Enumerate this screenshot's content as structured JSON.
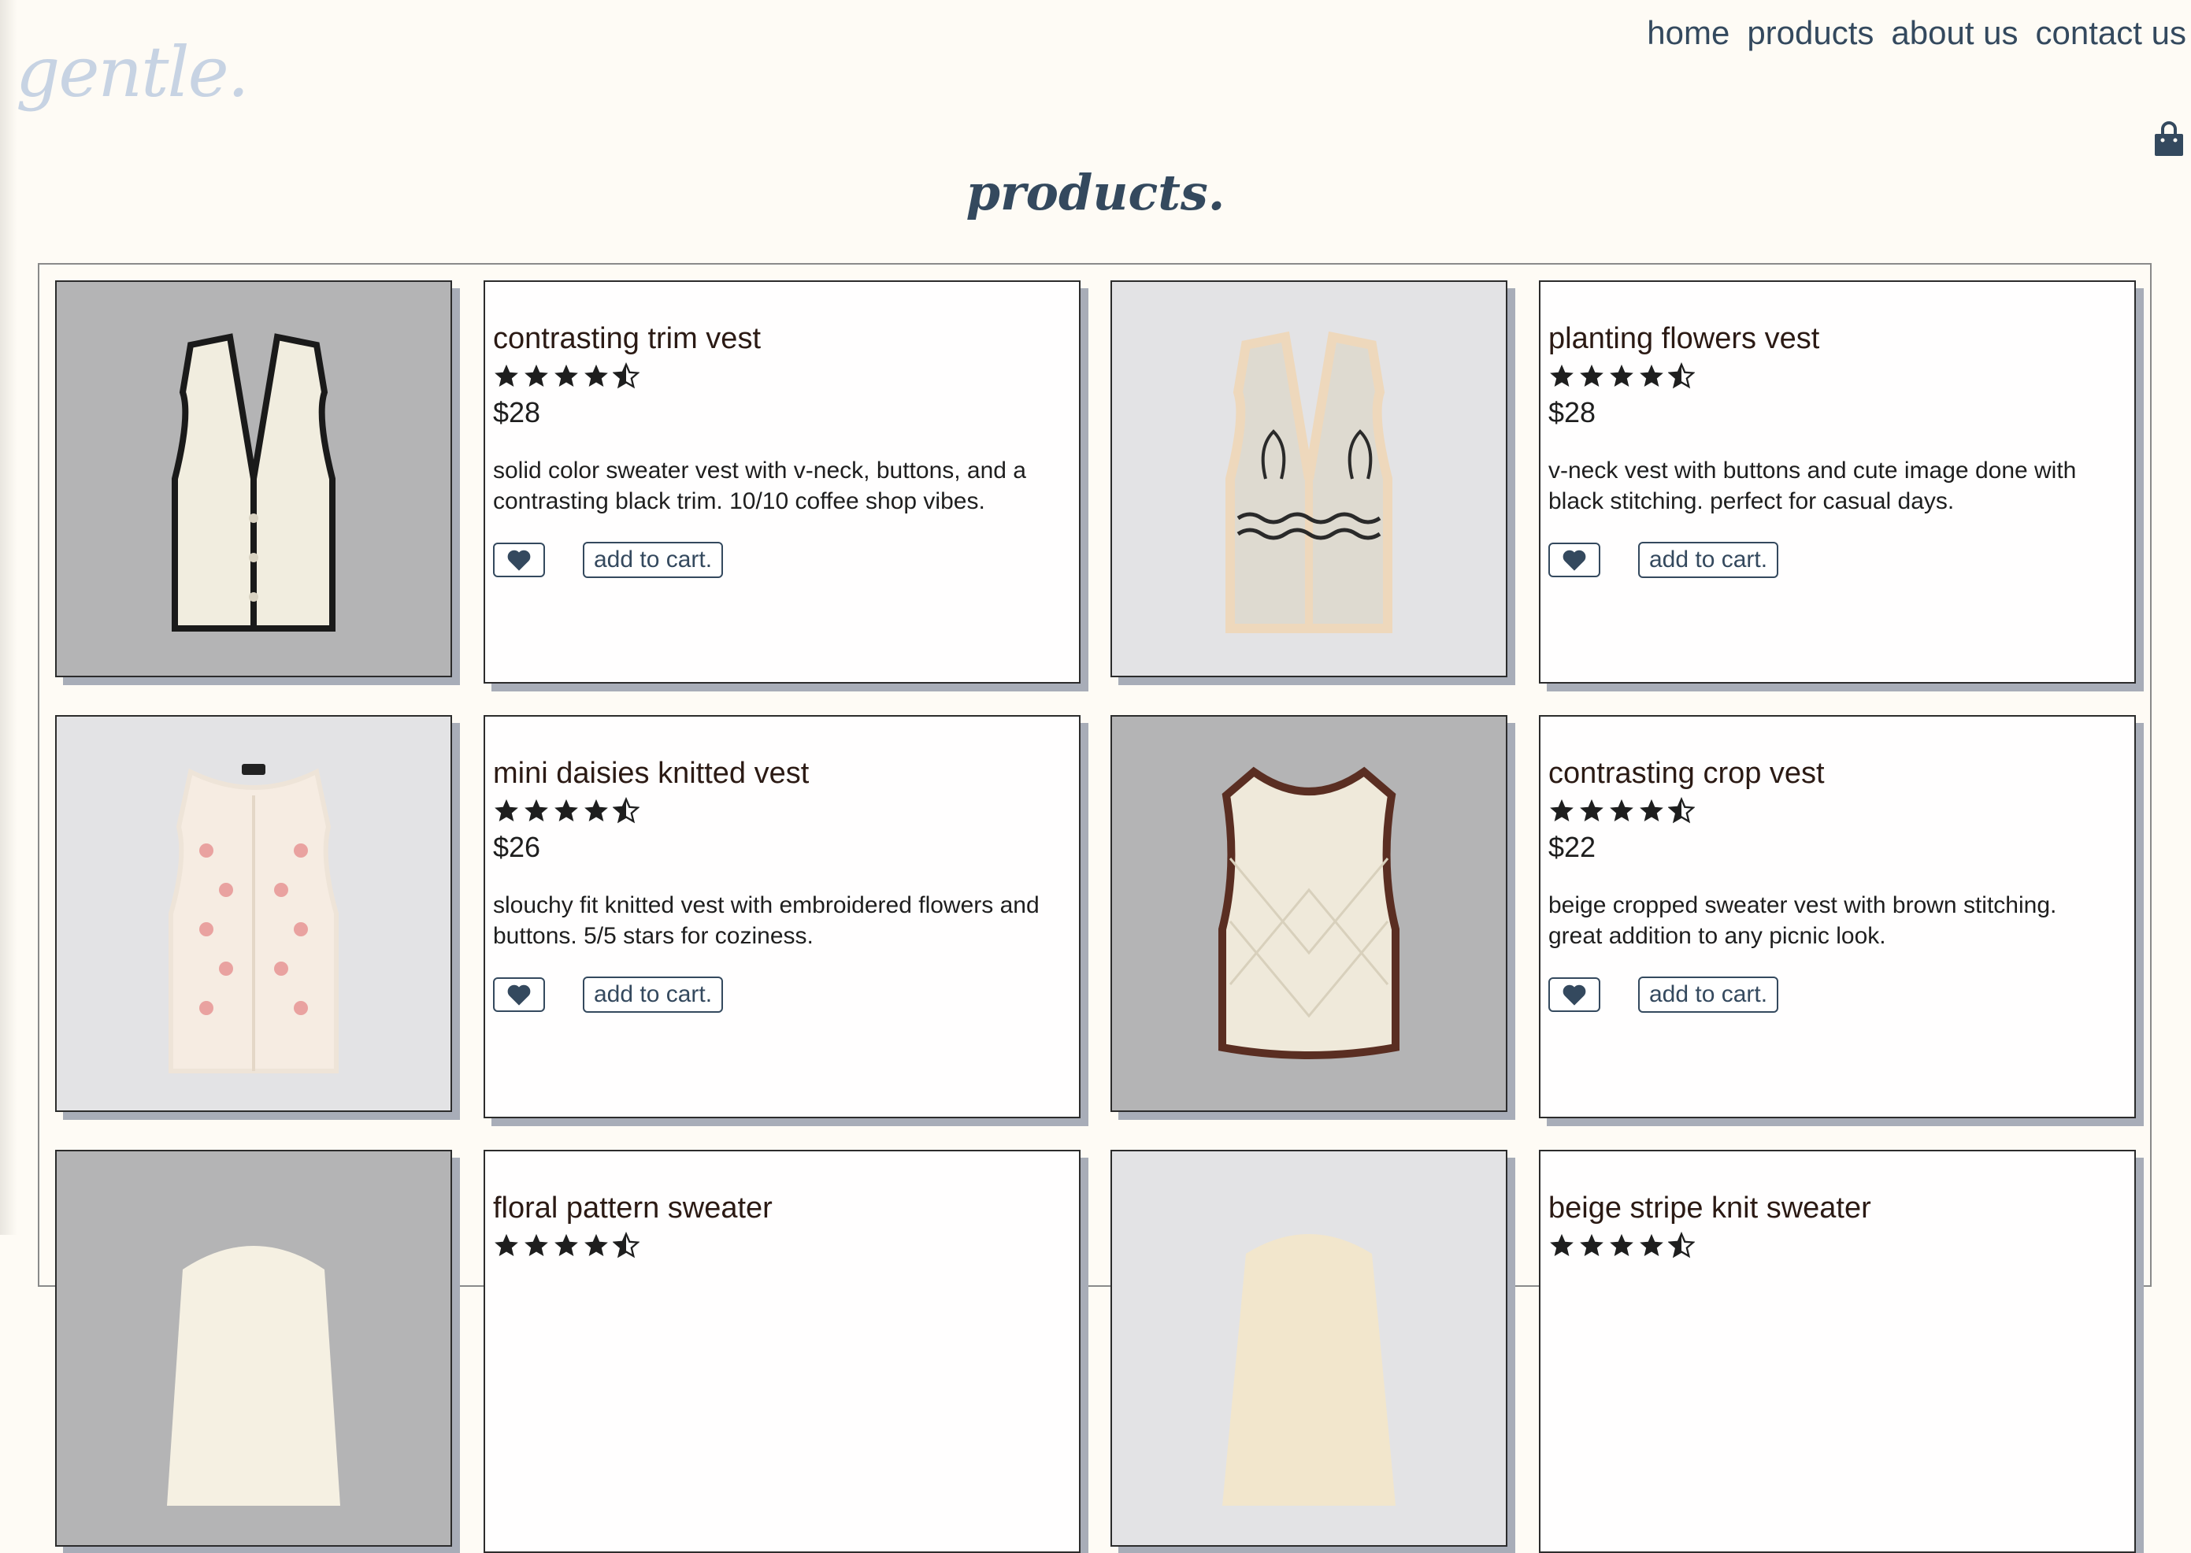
{
  "brand": {
    "logo_text": "gentle."
  },
  "nav": {
    "items": [
      "home",
      "products",
      "about us",
      "contact us"
    ]
  },
  "page": {
    "title": "products."
  },
  "colors": {
    "accent": "#34495e",
    "background": "#fefbf5",
    "logo": "#c7d3e3",
    "shadow": "#a8adb8"
  },
  "products": [
    {
      "name": "contrasting trim vest",
      "rating": 4.5,
      "price": "$28",
      "description": "solid color sweater vest with v-neck, buttons, and a contrasting black trim. 10/10 coffee shop vibes.",
      "cart_label": "add to cart.",
      "image": "vest-cream-black-trim"
    },
    {
      "name": "planting flowers vest",
      "rating": 4.5,
      "price": "$28",
      "description": "v-neck vest with buttons and cute image done with black stitching. perfect for casual days.",
      "cart_label": "add to cart.",
      "image": "vest-beige-flower-stitch"
    },
    {
      "name": "mini daisies knitted vest",
      "rating": 4.5,
      "price": "$26",
      "description": "slouchy fit knitted vest with embroidered flowers and buttons. 5/5 stars for coziness.",
      "cart_label": "add to cart.",
      "image": "vest-pink-daisies"
    },
    {
      "name": "contrasting crop vest",
      "rating": 4.5,
      "price": "$22",
      "description": "beige cropped sweater vest with brown stitching. great addition to any picnic look.",
      "cart_label": "add to cart.",
      "image": "vest-crop-brown-trim"
    },
    {
      "name": "floral pattern sweater",
      "rating": 4.5,
      "price": "",
      "description": "",
      "cart_label": "",
      "image": "sweater-floral"
    },
    {
      "name": "beige stripe knit sweater",
      "rating": 4.5,
      "price": "",
      "description": "",
      "cart_label": "",
      "image": "sweater-beige-stripe"
    }
  ]
}
